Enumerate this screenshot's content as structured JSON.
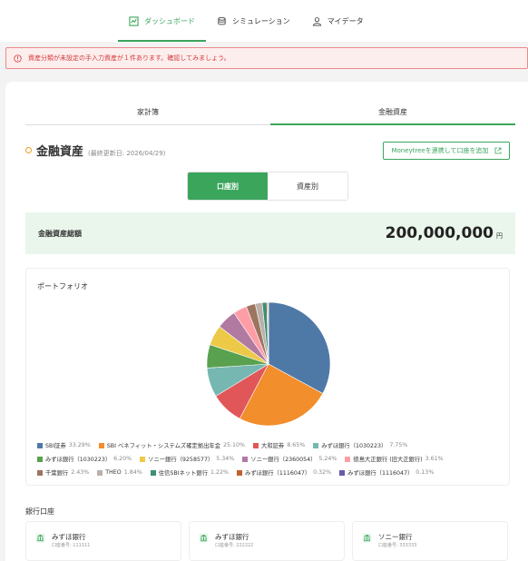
{
  "nav": {
    "items": [
      {
        "label": "ダッシュボード",
        "active": true
      },
      {
        "label": "シミュレーション",
        "active": false
      },
      {
        "label": "マイデータ",
        "active": false
      }
    ]
  },
  "alert": {
    "text": "資産分類が未設定の手入力資産が１件あります。確認してみましょう。"
  },
  "tabs": [
    {
      "label": "家計簿",
      "active": false
    },
    {
      "label": "金融資産",
      "active": true
    }
  ],
  "header": {
    "title": "金融資産",
    "updated": "(最終更新日: 2026/04/29)",
    "moneytree_button": "Moneytreeを連携して口座を追加"
  },
  "segment": {
    "by_account": "口座別",
    "by_asset": "資産別"
  },
  "total": {
    "label": "金融資産総額",
    "value": "200,000,000",
    "unit": "円"
  },
  "portfolio": {
    "title": "ポートフォリオ"
  },
  "chart_data": {
    "type": "pie",
    "slices": [
      {
        "name": "SBI証券",
        "pct_label": "33.29%",
        "value": 33.29,
        "color": "#4e79a7"
      },
      {
        "name": "SBI ベネフィット・システムズ確定拠出年金",
        "pct_label": "25.10%",
        "value": 25.1,
        "color": "#f28e2b"
      },
      {
        "name": "大和証券",
        "pct_label": "8.65%",
        "value": 8.65,
        "color": "#e15759"
      },
      {
        "name": "みずほ銀行（1030223）",
        "pct_label": "7.75%",
        "value": 7.75,
        "color": "#76b7b2"
      },
      {
        "name": "みずほ銀行（1030223）",
        "pct_label": "6.20%",
        "value": 6.2,
        "color": "#59a14f"
      },
      {
        "name": "ソニー銀行（9258577）",
        "pct_label": "5.34%",
        "value": 5.34,
        "color": "#edc948"
      },
      {
        "name": "ソニー銀行（2360054）",
        "pct_label": "5.24%",
        "value": 5.24,
        "color": "#b07aa1"
      },
      {
        "name": "徳島大正銀行 (旧大正銀行)",
        "pct_label": "3.61%",
        "value": 3.61,
        "color": "#ff9da7"
      },
      {
        "name": "千葉銀行",
        "pct_label": "2.43%",
        "value": 2.43,
        "color": "#9c755f"
      },
      {
        "name": "THEO",
        "pct_label": "1.84%",
        "value": 1.84,
        "color": "#bab0ac"
      },
      {
        "name": "住信SBIネット銀行",
        "pct_label": "1.22%",
        "value": 1.22,
        "color": "#3c8f74"
      },
      {
        "name": "みずほ銀行（1116047）",
        "pct_label": "0.32%",
        "value": 0.32,
        "color": "#c1612c"
      },
      {
        "name": "みずほ銀行（1116047）",
        "pct_label": "0.13%",
        "value": 0.13,
        "color": "#6a5aa8"
      }
    ]
  },
  "banks": {
    "title": "銀行口座",
    "items": [
      {
        "name": "みずほ銀行",
        "number": "口座番号: 111111"
      },
      {
        "name": "みずほ銀行",
        "number": "口座番号: 222222"
      },
      {
        "name": "ソニー銀行",
        "number": "口座番号: 333333"
      }
    ]
  },
  "colors": {
    "accent": "#3ba55c",
    "alert": "#d43a3a"
  }
}
